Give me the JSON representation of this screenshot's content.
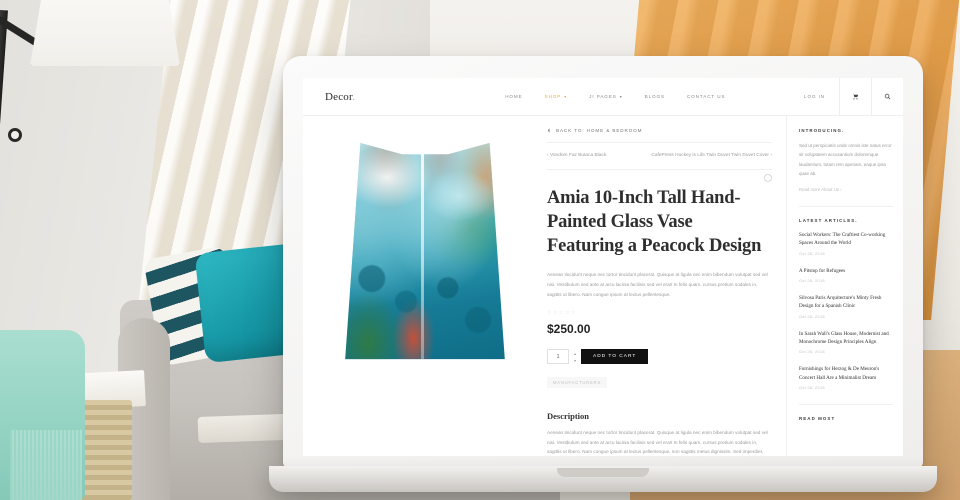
{
  "site": {
    "logo_text": "Decor",
    "logo_dot": "."
  },
  "nav": {
    "items": [
      {
        "label": "HOME",
        "has_caret": false,
        "active": false
      },
      {
        "label": "SHOP",
        "has_caret": true,
        "active": true
      },
      {
        "label": "JI PAGES",
        "has_caret": true,
        "active": false
      },
      {
        "label": "BLOGS",
        "has_caret": false,
        "active": false
      },
      {
        "label": "CONTACT US",
        "has_caret": false,
        "active": false
      }
    ],
    "login_label": "LOG IN",
    "cart_icon": "shopping-cart-icon",
    "search_icon": "search-icon"
  },
  "breadcrumb": {
    "back_label": "BACK TO: HOME & BEDROOM",
    "back_icon": "arrow-left-icon"
  },
  "pager": {
    "prev_arrow": "‹",
    "prev_label": "Vondom Faz Butaca Black",
    "next_label": "CafePress Hockey is Life Twin Duvet Twin Duvet Cover",
    "next_arrow": "›"
  },
  "product": {
    "title": "Amia 10-Inch Tall Hand-Painted Glass Vase Featuring a Peacock Design",
    "image_alt": "peacock-glass-vase",
    "description": "Aenean tincidunt neque nec tortor tincidunt placerat. Quisque at ligula nec enim bibendum volutpat sed vel nisi. Vestibulum sed ante at arcu lacinia facilisis sed vel erat! In felis quam, cursus pretium sodales in, sagittis ut libero. Nam congue ipsum at lectus pellentesque.",
    "rating_stars": "☆☆☆☆☆",
    "price": "$250.00",
    "quantity": "1",
    "add_to_cart_label": "ADD TO CART",
    "manufacturers_label": "MANUFACTURERS",
    "description_heading": "Description",
    "description_body": "Aenean tincidunt neque nec tortor tincidunt placerat. Quisque at ligula nec enim bibendum volutpat sed vel nisi. Vestibulum sed ante at arcu lacinia facilisis sed vel erat! In felis quam, cursus pretium sodales in, sagittis ut libero. Nam congue ipsum at lectus pellentesque, non sagittis metus dignissim. Sed imperdiet, purus et tristique facilisis, arcu est adipiscing ligula, quis auctor nisl quam id sem. Proin consectetur ante consectetur odio dapibus, a lacinia metus dapibus. Pellentesque sed mauris massa."
  },
  "sidebar": {
    "intro_heading": "INTRODUCING.",
    "intro_text": "Sed ut perspiciatis unde omnis iste natus error sit voluptatem accusantium doloremque laudantium, totam rem aperiam, eaque ipsa quae ab.",
    "intro_link": "Read more About Us ›",
    "articles_heading": "LATEST ARTICLES.",
    "articles": [
      {
        "title": "Social Workers: The Craftiest Co-working Spaces Around the World",
        "date": "Oct 28, 2018"
      },
      {
        "title": "A Pitstop for Refugees",
        "date": "Oct 28, 2018"
      },
      {
        "title": "Silvosa Paris Arquitecture's Minty Fresh Design for a Spanish Clinic",
        "date": "Oct 28, 2018"
      },
      {
        "title": "In Sarah Wall's Glass House, Modernist and Monochrome Design Principles Align",
        "date": "Oct 28, 2018"
      },
      {
        "title": "Furnishings for Herzog & De Meuron's Concert Hall Are a Minimalist Dream",
        "date": "Oct 28, 2018"
      }
    ],
    "read_most_heading": "READ MOST"
  },
  "colors": {
    "accent": "#f0a830",
    "cart_button": "#111111",
    "text_muted": "#9b9b9b"
  }
}
